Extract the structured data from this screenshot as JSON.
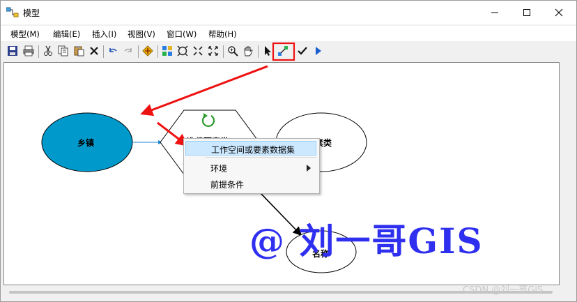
{
  "window": {
    "title": "模型"
  },
  "menu": [
    {
      "label": "模型(M)"
    },
    {
      "label": "编辑(E)"
    },
    {
      "label": "插入(I)"
    },
    {
      "label": "视图(V)"
    },
    {
      "label": "窗口(W)"
    },
    {
      "label": "帮助(H)"
    }
  ],
  "diagram": {
    "nodes": {
      "input": "乡镇",
      "tool": "迭代要素类",
      "output_features": "要素类",
      "output_name": "名称"
    }
  },
  "context_menu": {
    "items": [
      {
        "label": "工作空间或要素数据集",
        "highlighted": true
      },
      {
        "label": "环境",
        "submenu": true
      },
      {
        "label": "前提条件"
      }
    ]
  },
  "watermark": "@ 刘一哥GIS",
  "credit": "CSDN @刘一哥GIS",
  "colors": {
    "input_node": "#0099cc",
    "annotation_red": "#ee1111",
    "watermark_blue": "#2f2ff0"
  }
}
